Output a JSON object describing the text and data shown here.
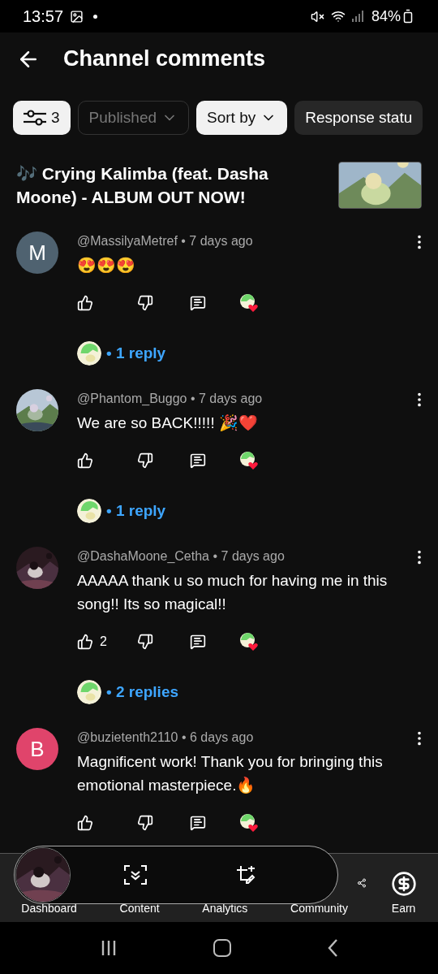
{
  "status_bar": {
    "time": "13:57",
    "battery": "84%"
  },
  "header": {
    "title": "Channel comments"
  },
  "filters": [
    {
      "kind": "count",
      "label": "3",
      "selected": true,
      "disabled": false
    },
    {
      "kind": "dropdown",
      "label": "Published",
      "selected": false,
      "disabled": true
    },
    {
      "kind": "dropdown",
      "label": "Sort by",
      "selected": true,
      "disabled": false
    },
    {
      "kind": "plain",
      "label": "Response statu",
      "selected": false,
      "disabled": false
    }
  ],
  "video": {
    "title": "🎶 Crying Kalimba (feat. Dasha Moone) - ALBUM OUT NOW!"
  },
  "comments": [
    {
      "author": "@MassilyaMetref",
      "separator": "•",
      "time": "7 days ago",
      "text": "😍😍😍",
      "avatar": {
        "kind": "letter",
        "letter": "M",
        "color": "#4f6270"
      },
      "hearted": true,
      "replies": "• 1 reply"
    },
    {
      "author": "@Phantom_Buggo",
      "separator": "•",
      "time": "7 days ago",
      "text": "We are so BACK!!!!! 🎉❤️",
      "hearted": true,
      "replies": "• 1 reply"
    },
    {
      "author": "@DashaMoone_Cetha",
      "separator": "•",
      "time": "7 days ago",
      "text": "AAAAA thank u so much for having me in this song!! Its so magical!!",
      "likes": "2",
      "hearted": true,
      "replies": "• 2 replies"
    },
    {
      "author": "@buzietenth2110",
      "separator": "•",
      "time": "6 days ago",
      "text": "Magnificent work! Thank you for bringing this emotional masterpiece.🔥",
      "avatar": {
        "kind": "letter",
        "letter": "B",
        "color": "#e0446b"
      },
      "hearted": true
    }
  ],
  "bottom_nav": [
    {
      "label": "Dashboard"
    },
    {
      "label": "Content"
    },
    {
      "label": "Analytics"
    },
    {
      "label": "Community"
    },
    {
      "label": "Earn"
    }
  ]
}
